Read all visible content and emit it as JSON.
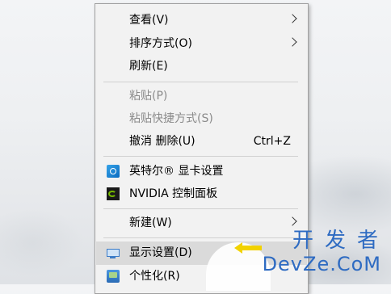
{
  "context_menu": {
    "items": [
      {
        "label": "查看(V)",
        "submenu": true,
        "enabled": true
      },
      {
        "label": "排序方式(O)",
        "submenu": true,
        "enabled": true
      },
      {
        "label": "刷新(E)",
        "submenu": false,
        "enabled": true
      },
      {
        "label": "粘贴(P)",
        "submenu": false,
        "enabled": false
      },
      {
        "label": "粘贴快捷方式(S)",
        "submenu": false,
        "enabled": false
      },
      {
        "label": "撤消 删除(U)",
        "shortcut": "Ctrl+Z",
        "submenu": false,
        "enabled": true
      },
      {
        "label": "英特尔® 显卡设置",
        "icon": "intel-graphics-icon",
        "enabled": true
      },
      {
        "label": "NVIDIA 控制面板",
        "icon": "nvidia-icon",
        "enabled": true
      },
      {
        "label": "新建(W)",
        "submenu": true,
        "enabled": true
      },
      {
        "label": "显示设置(D)",
        "icon": "display-icon",
        "enabled": true,
        "selected": true
      },
      {
        "label": "个性化(R)",
        "icon": "personalize-icon",
        "enabled": true
      }
    ]
  },
  "watermark": {
    "chinese": "开发者",
    "english": "DevZe.CoM",
    "color": "#2e6bc2",
    "arrow_color": "#f2d200"
  },
  "colors": {
    "menu_bg": "#f2f2f2",
    "selected_bg": "#dadada",
    "disabled_text": "#8b8b8b"
  }
}
